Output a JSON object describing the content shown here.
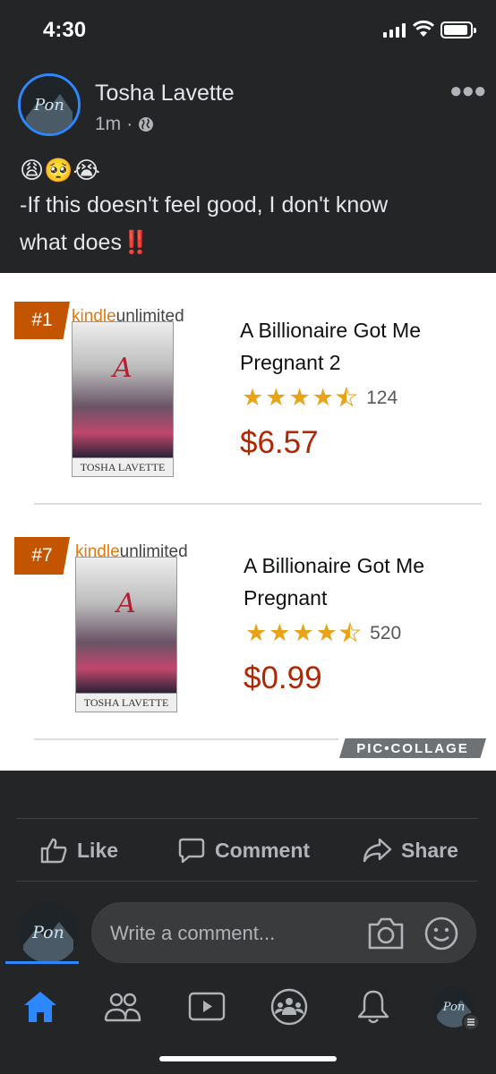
{
  "status": {
    "time": "4:30"
  },
  "post": {
    "author": "Tosha Lavette",
    "time": "1m",
    "separator": "·",
    "emojis": "😩🥺😭",
    "text_line1": "-If this doesn't feel good, I don't know",
    "text_line2": "what does",
    "text_end_emoji": "‼️"
  },
  "image": {
    "books": [
      {
        "rank": "#1",
        "badge_word_1": "kindle",
        "badge_word_2": "unlimited",
        "title": "A Billionaire Got Me Pregnant 2",
        "rating": 4.5,
        "rating_count": "124",
        "price": "$6.57",
        "cover_title": "A",
        "cover_author": "TOSHA LAVETTE"
      },
      {
        "rank": "#7",
        "badge_word_1": "kindle",
        "badge_word_2": "unlimited",
        "title": "A Billionaire Got Me Pregnant",
        "rating": 4.5,
        "rating_count": "520",
        "price": "$0.99",
        "cover_title": "A",
        "cover_author": "TOSHA LAVETTE"
      }
    ],
    "watermark": "PIC•COLLAGE"
  },
  "actions": {
    "like": "Like",
    "comment": "Comment",
    "share": "Share"
  },
  "comment_bar": {
    "placeholder": "Write a comment..."
  },
  "colors": {
    "accent": "#2d88ff",
    "price": "#b12704",
    "badge": "#c45500",
    "star": "#e8a317",
    "background": "#242526"
  },
  "icons": {
    "nav": [
      "home-icon",
      "friends-icon",
      "watch-icon",
      "groups-icon",
      "notifications-icon",
      "profile-avatar"
    ],
    "actions": [
      "like-icon",
      "comment-icon",
      "share-icon"
    ]
  }
}
